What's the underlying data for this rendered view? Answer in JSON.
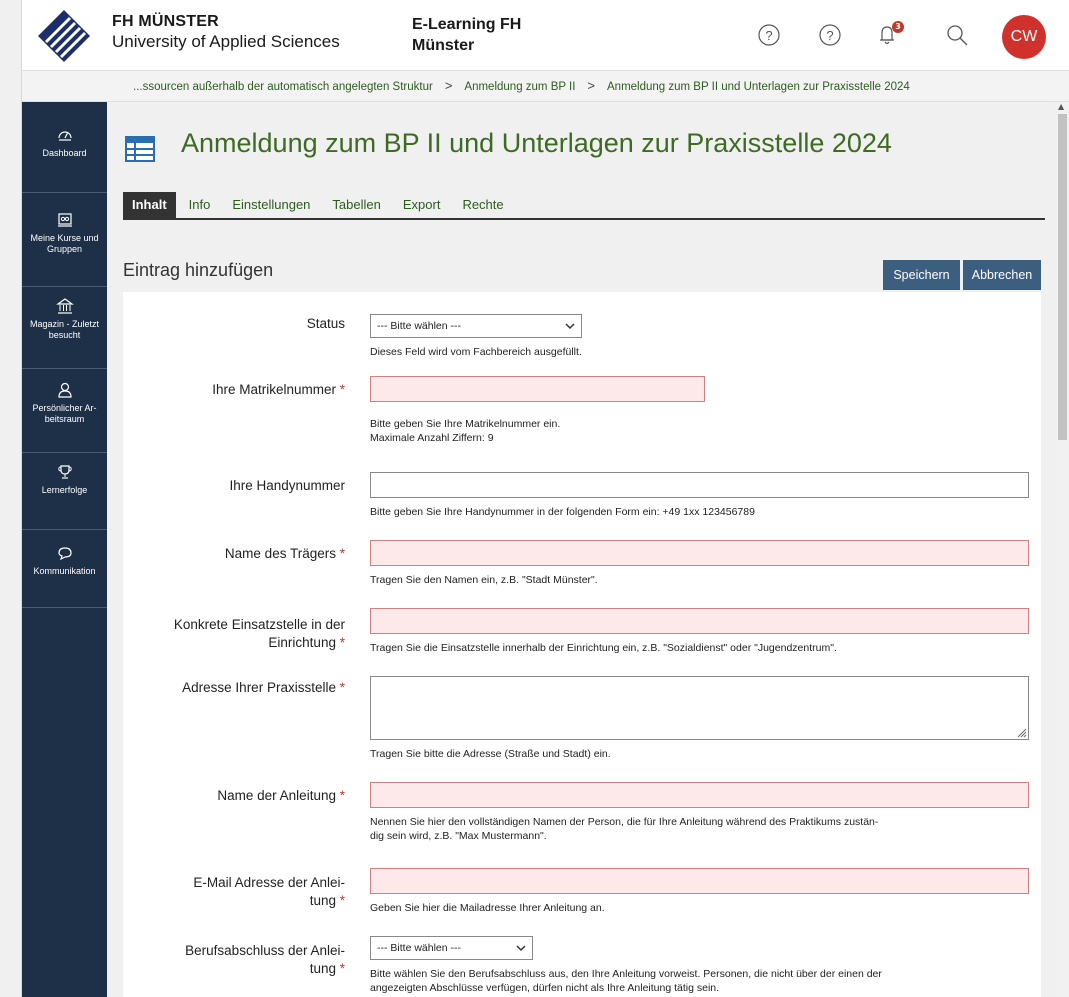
{
  "header": {
    "org_line1": "FH MÜNSTER",
    "org_line2": "University of Applied Sciences",
    "elearning_line1": "E-Learning FH",
    "elearning_line2": "Münster",
    "notification_count": "3",
    "avatar_initials": "CW"
  },
  "breadcrumb": {
    "items": [
      "...ssourcen außerhalb der automatisch angelegten Struktur",
      "Anmeldung zum BP II",
      "Anmeldung zum BP II und Unterlagen zur Praxisstelle 2024"
    ]
  },
  "sidebar": {
    "items": [
      {
        "label_lines": [
          "Dashboard"
        ],
        "icon": "dashboard-icon"
      },
      {
        "label_lines": [
          "Meine Kurse und",
          "Gruppen"
        ],
        "icon": "courses-icon"
      },
      {
        "label_lines": [
          "Magazin - Zuletzt",
          "besucht"
        ],
        "icon": "repository-icon"
      },
      {
        "label_lines": [
          "Persönlicher Ar-",
          "beitsraum"
        ],
        "icon": "personal-icon"
      },
      {
        "label_lines": [
          "Lernerfolge"
        ],
        "icon": "trophy-icon"
      },
      {
        "label_lines": [
          "Kommunikation"
        ],
        "icon": "chat-icon"
      }
    ]
  },
  "page": {
    "title": "Anmeldung zum BP II und Unterlagen zur Praxisstelle 2024",
    "tabs": [
      "Inhalt",
      "Info",
      "Einstellungen",
      "Tabellen",
      "Export",
      "Rechte"
    ],
    "active_tab": "Inhalt",
    "section_title": "Eintrag hinzufügen",
    "save_label": "Speichern",
    "cancel_label": "Abbrechen"
  },
  "form": {
    "required_mark": "*",
    "status": {
      "label": "Status",
      "value": "--- Bitte wählen ---",
      "help": "Dieses Feld wird vom Fachbereich ausgefüllt."
    },
    "matrikel": {
      "label": "Ihre Matrikelnummer",
      "help1": "Bitte geben Sie Ihre Matrikelnummer ein.",
      "help2": "Maximale Anzahl Ziffern: 9"
    },
    "handy": {
      "label": "Ihre Handynummer",
      "help": "Bitte geben Sie Ihre Handynummer in der folgenden Form ein: +49 1xx 123456789"
    },
    "traeger": {
      "label": "Name des Trägers",
      "help": "Tragen Sie den Namen ein, z.B. \"Stadt Münster\"."
    },
    "einsatz": {
      "label_line1": "Konkrete Einsatzstelle in der",
      "label_line2": "Einrichtung",
      "help": "Tragen Sie die Einsatzstelle innerhalb der Einrichtung ein, z.B. \"Sozialdienst\" oder \"Jugendzentrum\"."
    },
    "adresse": {
      "label": "Adresse Ihrer Praxisstelle",
      "help": "Tragen Sie bitte die Adresse (Straße und Stadt) ein."
    },
    "anleitung": {
      "label": "Name der Anleitung",
      "help1": "Nennen Sie hier den vollständigen Namen der Person, die für Ihre Anleitung während des Praktikums zustän-",
      "help2": "dig sein wird, z.B. \"Max Mustermann\"."
    },
    "email": {
      "label_line1": "E-Mail Adresse der Anlei-",
      "label_line2": "tung",
      "help": "Geben Sie hier die Mailadresse Ihrer Anleitung an."
    },
    "beruf": {
      "label_line1": "Berufsabschluss der Anlei-",
      "label_line2": "tung",
      "value": "--- Bitte wählen ---",
      "help1": "Bitte wählen Sie den Berufsabschluss aus, den Ihre Anleitung vorweist. Personen, die nicht über der einen der",
      "help2": "angezeigten Abschlüsse verfügen, dürfen nicht als Ihre Anleitung tätig sein."
    }
  }
}
